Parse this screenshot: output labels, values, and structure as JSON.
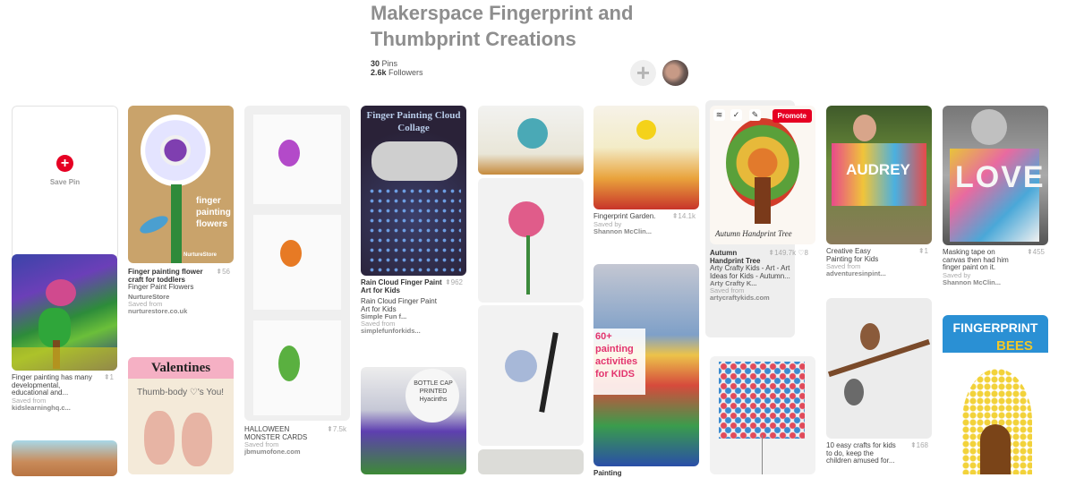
{
  "board": {
    "title": "Makerspace Fingerprint and Thumbprint Creations",
    "pins_count": "30",
    "pins_label": "Pins",
    "followers_count": "2.6k",
    "followers_label": "Followers",
    "add_symbol": "+"
  },
  "save_pin": {
    "label": "Save Pin",
    "symbol": "+"
  },
  "pins": {
    "c1": {
      "desc": "Finger painting has many developmental, educational and...",
      "repins": "1",
      "saved_from": "Saved from",
      "source": "kidslearninghq.c..."
    },
    "c2a": {
      "title": "Finger painting flower craft for toddlers",
      "desc": "Finger Paint Flowers",
      "repins": "56",
      "board": "NurtureStore",
      "saved_from": "Saved from",
      "source": "nurturestore.co.uk",
      "img_text": "finger painting flowers",
      "img_credit": "NurtureStore"
    },
    "c2b": {
      "img_text": "Valentines",
      "img_text2": "Thumb-body ♡'s You!"
    },
    "c3": {
      "desc": "HALLOWEEN MONSTER CARDS",
      "repins": "7.5k",
      "saved_from": "Saved from",
      "source": "jbmumofone.com"
    },
    "c4a": {
      "title": "Rain Cloud Finger Paint Art for Kids",
      "desc": "Rain Cloud Finger Paint Art for Kids",
      "repins": "962",
      "board": "Simple Fun f...",
      "saved_from": "Saved from",
      "source": "simplefunforkids...",
      "img_text": "Finger Painting Cloud Collage"
    },
    "c4b": {
      "img_text": "BOTTLE CAP PRINTED Hyacinths"
    },
    "c6a": {
      "desc": "Fingerprint Garden.",
      "repins": "14.1k",
      "saved_by": "Saved by",
      "user": "Shannon McClin..."
    },
    "c6b": {
      "img_text": "60+ painting activities for KIDS"
    },
    "c6c": {
      "desc": "Painting"
    },
    "c7a": {
      "title": "Autumn Handprint Tree",
      "desc": "Arty Crafty Kids - Art - Art Ideas for Kids - Autumn...",
      "repins": "149.7k",
      "likes": "8",
      "board": "Arty Crafty K...",
      "saved_from": "Saved from",
      "source": "artycraftykids.com",
      "promote": "Promote",
      "img_text": "Autumn Handprint Tree"
    },
    "c8a": {
      "desc": "Creative Easy Painting for Kids",
      "repins": "1",
      "saved_from": "Saved from",
      "source": "adventuresinpint...",
      "img_text": "AUDREY"
    },
    "c8b": {
      "desc": "10 easy crafts for kids to do, keep the children amused for...",
      "repins": "168"
    },
    "c9a": {
      "desc": "Masking tape on canvas then had him finger paint on it.",
      "repins": "455",
      "saved_by": "Saved by",
      "user": "Shannon McClin...",
      "img_text": "LOVE"
    },
    "c9b": {
      "img_text": "FINGERPRINT",
      "img_text2": "BEES"
    }
  },
  "colors": {
    "accent": "#e60023",
    "title": "#8e8e8e"
  },
  "icons": [
    "plus-icon",
    "pin-icon",
    "layers-icon",
    "check-icon",
    "pencil-icon",
    "heart-icon"
  ]
}
